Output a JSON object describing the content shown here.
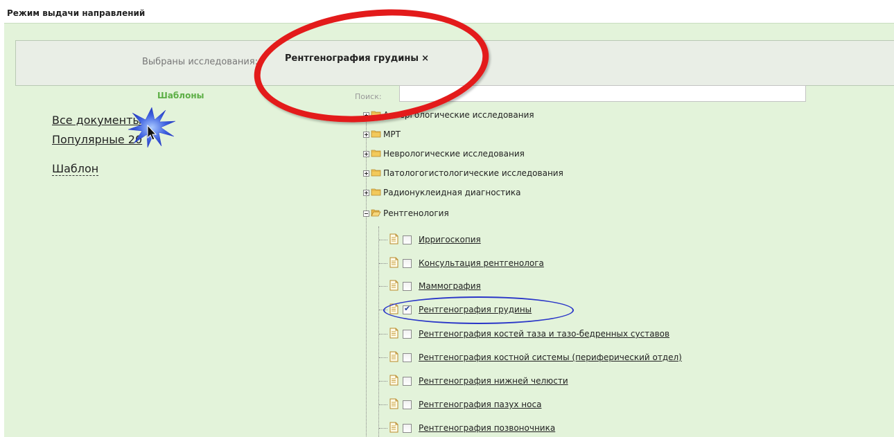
{
  "header": {
    "title": "Режим выдачи направлений"
  },
  "selected": {
    "label": "Выбраны исследования:",
    "items": [
      {
        "text": "Рентгенография грудины",
        "remove_icon": "×"
      }
    ]
  },
  "templates": {
    "title": "Шаблоны",
    "links": [
      "Все документы",
      "Популярные 20"
    ],
    "template_link": "Шаблон"
  },
  "search": {
    "label": "Поиск:",
    "value": ""
  },
  "tree": {
    "categories": [
      "Аллергологические исследования",
      "МРТ",
      "Неврологические исследования",
      "Патологогистологические исследования",
      "Радионуклеидная диагностика"
    ],
    "expanded": {
      "label": "Рентгенология",
      "children": [
        {
          "label": "Ирригоскопия",
          "checked": false
        },
        {
          "label": "Консультация рентгенолога",
          "checked": false
        },
        {
          "label": "Маммография",
          "checked": false
        },
        {
          "label": "Рентгенография грудины",
          "checked": true
        },
        {
          "label": "Рентгенография костей таза и тазо-бедренных суставов",
          "checked": false
        },
        {
          "label": "Рентгенография костной системы (периферический отдел)",
          "checked": false
        },
        {
          "label": "Рентгенография нижней челюсти",
          "checked": false
        },
        {
          "label": "Рентгенография пазух носа",
          "checked": false
        },
        {
          "label": "Рентгенография позвоночника",
          "checked": false
        }
      ]
    }
  },
  "colors": {
    "background": "#e3f3da",
    "accent_green": "#5cae45",
    "highlight_red": "#e31b1b",
    "highlight_blue": "#2a36c8"
  },
  "icons": {
    "folder": "folder-icon",
    "folder_open": "folder-open-icon",
    "document": "document-icon",
    "expand": "plus-icon",
    "collapse": "minus-icon",
    "remove": "close-icon",
    "cursor": "mouse-pointer-icon"
  }
}
